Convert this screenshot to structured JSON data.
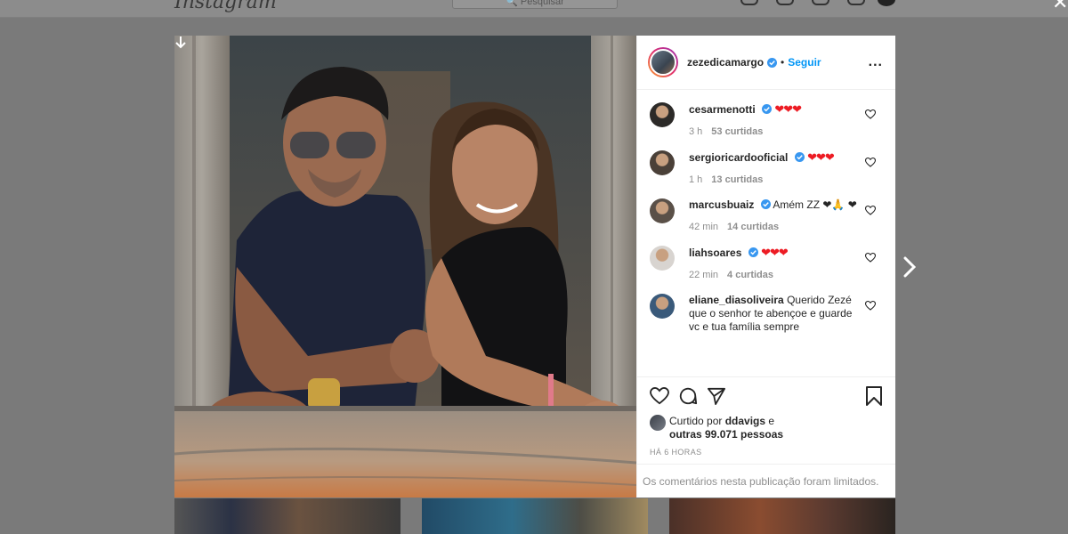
{
  "background_page": {
    "logo": "Instagram",
    "search_placeholder": "Pesquisar"
  },
  "post": {
    "author": {
      "username": "zezedicamargo",
      "verified": true,
      "follow_label": "Seguir",
      "more_label": "..."
    },
    "comments": [
      {
        "username": "cesarmenotti",
        "verified": true,
        "text": "❤❤❤",
        "time": "3 h",
        "likes": "53 curtidas",
        "avatar_color": "#2c2a28"
      },
      {
        "username": "sergioricardooficial",
        "verified": true,
        "text": "❤❤❤",
        "time": "1 h",
        "likes": "13 curtidas",
        "avatar_color": "#4a4038"
      },
      {
        "username": "marcusbuaiz",
        "verified": true,
        "text": "Amém ZZ ❤🙏 ❤",
        "time": "42 min",
        "likes": "14 curtidas",
        "avatar_color": "#5a5048"
      },
      {
        "username": "liahsoares",
        "verified": true,
        "text": "❤❤❤",
        "time": "22 min",
        "likes": "4 curtidas",
        "avatar_color": "#d8d4d0"
      },
      {
        "username": "eliane_diasoliveira",
        "verified": false,
        "text": "Querido Zezé que o senhor te abençoe e guarde vc e tua família sempre",
        "time": "",
        "likes": "",
        "avatar_color": "#3a5a7a"
      }
    ],
    "liked_by": {
      "prefix": "Curtido por",
      "user": "ddavigs",
      "conjunction": "e",
      "others": "outras 99.071 pessoas"
    },
    "timestamp": "HÁ 6 HORAS",
    "comments_limited": "Os comentários nesta publicação foram limitados."
  },
  "colors": {
    "accent": "#0095f6",
    "verified_badge": "#3897f0",
    "heart_red": "#ed1c24",
    "overlay": "#7a7a7a"
  }
}
